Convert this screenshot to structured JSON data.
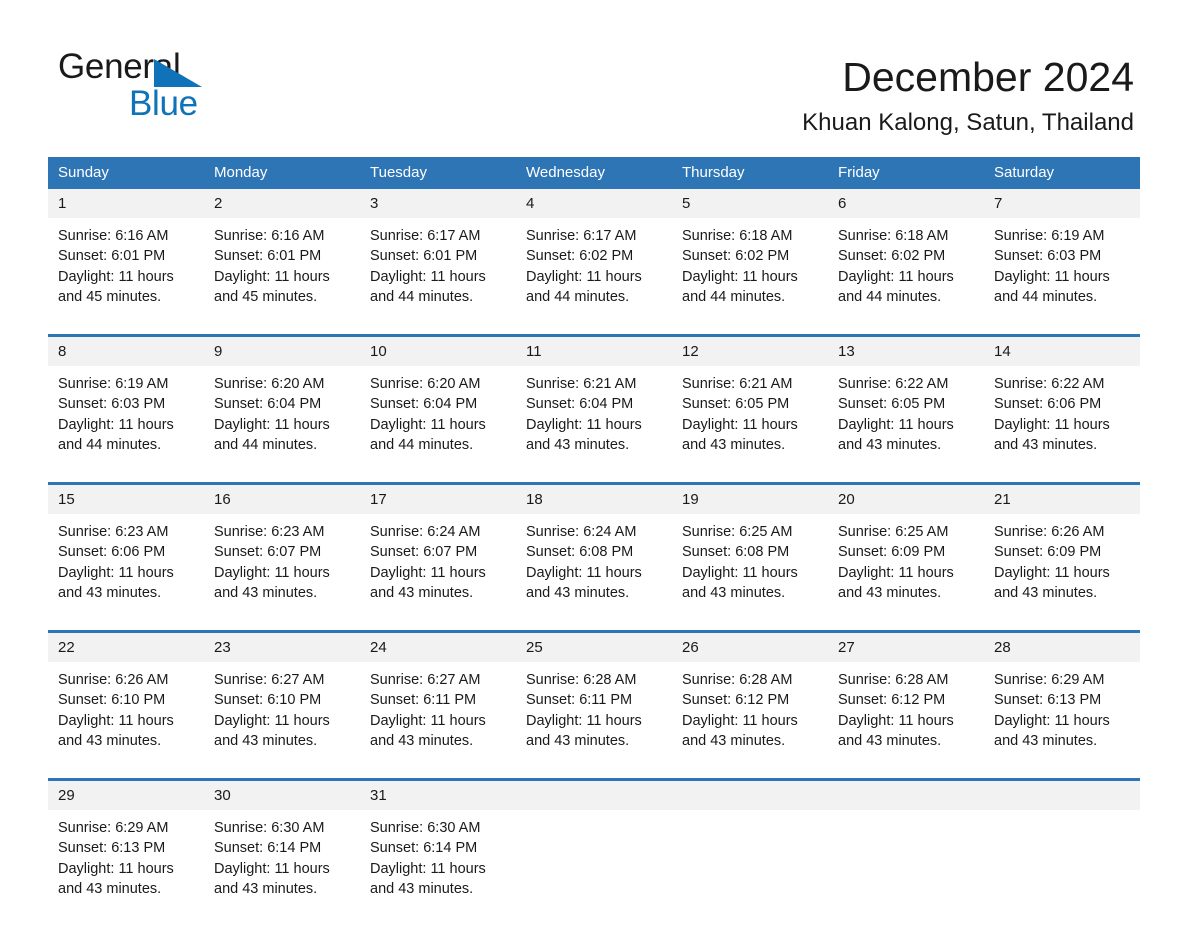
{
  "brand": {
    "name_part1": "General",
    "name_part2": "Blue",
    "color_blue": "#1072b8"
  },
  "header": {
    "month_title": "December 2024",
    "location": "Khuan Kalong, Satun, Thailand"
  },
  "theme": {
    "header_blue": "#2e75b6",
    "daynum_band": "#f2f2f2",
    "text": "#1a1a1a"
  },
  "weekday_headers": [
    "Sunday",
    "Monday",
    "Tuesday",
    "Wednesday",
    "Thursday",
    "Friday",
    "Saturday"
  ],
  "weeks": [
    {
      "days": [
        {
          "num": "1",
          "sunrise": "Sunrise: 6:16 AM",
          "sunset": "Sunset: 6:01 PM",
          "daylight": "Daylight: 11 hours and 45 minutes."
        },
        {
          "num": "2",
          "sunrise": "Sunrise: 6:16 AM",
          "sunset": "Sunset: 6:01 PM",
          "daylight": "Daylight: 11 hours and 45 minutes."
        },
        {
          "num": "3",
          "sunrise": "Sunrise: 6:17 AM",
          "sunset": "Sunset: 6:01 PM",
          "daylight": "Daylight: 11 hours and 44 minutes."
        },
        {
          "num": "4",
          "sunrise": "Sunrise: 6:17 AM",
          "sunset": "Sunset: 6:02 PM",
          "daylight": "Daylight: 11 hours and 44 minutes."
        },
        {
          "num": "5",
          "sunrise": "Sunrise: 6:18 AM",
          "sunset": "Sunset: 6:02 PM",
          "daylight": "Daylight: 11 hours and 44 minutes."
        },
        {
          "num": "6",
          "sunrise": "Sunrise: 6:18 AM",
          "sunset": "Sunset: 6:02 PM",
          "daylight": "Daylight: 11 hours and 44 minutes."
        },
        {
          "num": "7",
          "sunrise": "Sunrise: 6:19 AM",
          "sunset": "Sunset: 6:03 PM",
          "daylight": "Daylight: 11 hours and 44 minutes."
        }
      ]
    },
    {
      "days": [
        {
          "num": "8",
          "sunrise": "Sunrise: 6:19 AM",
          "sunset": "Sunset: 6:03 PM",
          "daylight": "Daylight: 11 hours and 44 minutes."
        },
        {
          "num": "9",
          "sunrise": "Sunrise: 6:20 AM",
          "sunset": "Sunset: 6:04 PM",
          "daylight": "Daylight: 11 hours and 44 minutes."
        },
        {
          "num": "10",
          "sunrise": "Sunrise: 6:20 AM",
          "sunset": "Sunset: 6:04 PM",
          "daylight": "Daylight: 11 hours and 44 minutes."
        },
        {
          "num": "11",
          "sunrise": "Sunrise: 6:21 AM",
          "sunset": "Sunset: 6:04 PM",
          "daylight": "Daylight: 11 hours and 43 minutes."
        },
        {
          "num": "12",
          "sunrise": "Sunrise: 6:21 AM",
          "sunset": "Sunset: 6:05 PM",
          "daylight": "Daylight: 11 hours and 43 minutes."
        },
        {
          "num": "13",
          "sunrise": "Sunrise: 6:22 AM",
          "sunset": "Sunset: 6:05 PM",
          "daylight": "Daylight: 11 hours and 43 minutes."
        },
        {
          "num": "14",
          "sunrise": "Sunrise: 6:22 AM",
          "sunset": "Sunset: 6:06 PM",
          "daylight": "Daylight: 11 hours and 43 minutes."
        }
      ]
    },
    {
      "days": [
        {
          "num": "15",
          "sunrise": "Sunrise: 6:23 AM",
          "sunset": "Sunset: 6:06 PM",
          "daylight": "Daylight: 11 hours and 43 minutes."
        },
        {
          "num": "16",
          "sunrise": "Sunrise: 6:23 AM",
          "sunset": "Sunset: 6:07 PM",
          "daylight": "Daylight: 11 hours and 43 minutes."
        },
        {
          "num": "17",
          "sunrise": "Sunrise: 6:24 AM",
          "sunset": "Sunset: 6:07 PM",
          "daylight": "Daylight: 11 hours and 43 minutes."
        },
        {
          "num": "18",
          "sunrise": "Sunrise: 6:24 AM",
          "sunset": "Sunset: 6:08 PM",
          "daylight": "Daylight: 11 hours and 43 minutes."
        },
        {
          "num": "19",
          "sunrise": "Sunrise: 6:25 AM",
          "sunset": "Sunset: 6:08 PM",
          "daylight": "Daylight: 11 hours and 43 minutes."
        },
        {
          "num": "20",
          "sunrise": "Sunrise: 6:25 AM",
          "sunset": "Sunset: 6:09 PM",
          "daylight": "Daylight: 11 hours and 43 minutes."
        },
        {
          "num": "21",
          "sunrise": "Sunrise: 6:26 AM",
          "sunset": "Sunset: 6:09 PM",
          "daylight": "Daylight: 11 hours and 43 minutes."
        }
      ]
    },
    {
      "days": [
        {
          "num": "22",
          "sunrise": "Sunrise: 6:26 AM",
          "sunset": "Sunset: 6:10 PM",
          "daylight": "Daylight: 11 hours and 43 minutes."
        },
        {
          "num": "23",
          "sunrise": "Sunrise: 6:27 AM",
          "sunset": "Sunset: 6:10 PM",
          "daylight": "Daylight: 11 hours and 43 minutes."
        },
        {
          "num": "24",
          "sunrise": "Sunrise: 6:27 AM",
          "sunset": "Sunset: 6:11 PM",
          "daylight": "Daylight: 11 hours and 43 minutes."
        },
        {
          "num": "25",
          "sunrise": "Sunrise: 6:28 AM",
          "sunset": "Sunset: 6:11 PM",
          "daylight": "Daylight: 11 hours and 43 minutes."
        },
        {
          "num": "26",
          "sunrise": "Sunrise: 6:28 AM",
          "sunset": "Sunset: 6:12 PM",
          "daylight": "Daylight: 11 hours and 43 minutes."
        },
        {
          "num": "27",
          "sunrise": "Sunrise: 6:28 AM",
          "sunset": "Sunset: 6:12 PM",
          "daylight": "Daylight: 11 hours and 43 minutes."
        },
        {
          "num": "28",
          "sunrise": "Sunrise: 6:29 AM",
          "sunset": "Sunset: 6:13 PM",
          "daylight": "Daylight: 11 hours and 43 minutes."
        }
      ]
    },
    {
      "days": [
        {
          "num": "29",
          "sunrise": "Sunrise: 6:29 AM",
          "sunset": "Sunset: 6:13 PM",
          "daylight": "Daylight: 11 hours and 43 minutes."
        },
        {
          "num": "30",
          "sunrise": "Sunrise: 6:30 AM",
          "sunset": "Sunset: 6:14 PM",
          "daylight": "Daylight: 11 hours and 43 minutes."
        },
        {
          "num": "31",
          "sunrise": "Sunrise: 6:30 AM",
          "sunset": "Sunset: 6:14 PM",
          "daylight": "Daylight: 11 hours and 43 minutes."
        },
        {
          "num": "",
          "sunrise": "",
          "sunset": "",
          "daylight": ""
        },
        {
          "num": "",
          "sunrise": "",
          "sunset": "",
          "daylight": ""
        },
        {
          "num": "",
          "sunrise": "",
          "sunset": "",
          "daylight": ""
        },
        {
          "num": "",
          "sunrise": "",
          "sunset": "",
          "daylight": ""
        }
      ]
    }
  ]
}
